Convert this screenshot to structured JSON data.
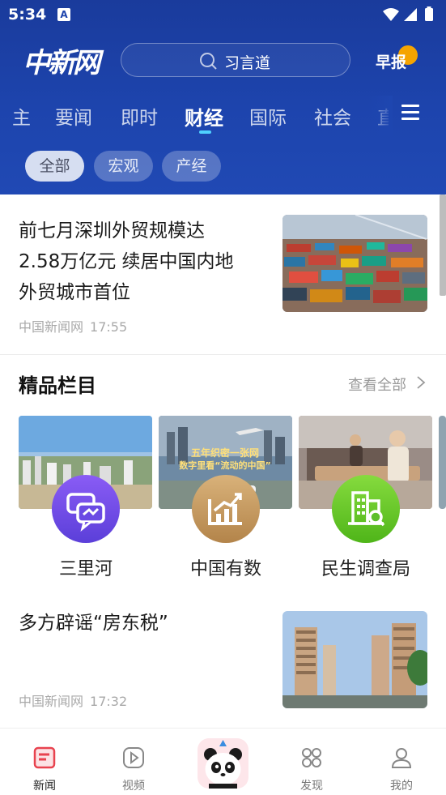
{
  "status_bar": {
    "time": "5:34",
    "notification_icon": "A"
  },
  "header": {
    "logo_text": "中新网",
    "search": {
      "placeholder": "习言道",
      "icon": "search-icon"
    },
    "morning_report": "早报",
    "tabs": [
      "主",
      "要闻",
      "即时",
      "财经",
      "国际",
      "社会",
      "直"
    ],
    "active_tab": "财经",
    "menu_icon": "hamburger-icon",
    "chips": [
      {
        "label": "全部",
        "active": true
      },
      {
        "label": "宏观",
        "active": false
      },
      {
        "label": "产经",
        "active": false
      }
    ]
  },
  "articles": [
    {
      "title_lines": [
        "前七月深圳外贸规模达",
        "2.58万亿元  续居中国内地",
        "外贸城市首位"
      ],
      "source": "中国新闻网",
      "time": "17:55",
      "thumbnail": "shipping-containers-port"
    },
    {
      "title_lines": [
        "多方辟谣“房东税”"
      ],
      "source": "中国新闻网",
      "time": "17:32",
      "thumbnail": "apartment-buildings"
    }
  ],
  "premium": {
    "title": "精品栏目",
    "see_all": "查看全部",
    "card_banner_text": [
      "五年织密一张网",
      "数字里看“流动的中国”"
    ],
    "items": [
      {
        "label": "三里河",
        "icon": "chat-bubbles-icon",
        "color": "#6b4fe6"
      },
      {
        "label": "中国有数",
        "icon": "chart-growth-icon",
        "color": "#c99a5e"
      },
      {
        "label": "民生调查局",
        "icon": "building-search-icon",
        "color": "#5cbf2a"
      }
    ]
  },
  "bottom_nav": [
    {
      "label": "新闻",
      "icon": "news-icon",
      "active": true
    },
    {
      "label": "视频",
      "icon": "play-icon",
      "active": false
    },
    {
      "label": "",
      "icon": "panda-icon",
      "active": false
    },
    {
      "label": "发现",
      "icon": "discover-icon",
      "active": false
    },
    {
      "label": "我的",
      "icon": "profile-icon",
      "active": false
    }
  ],
  "colors": {
    "header_blue": "#1d44ad",
    "accent_underline": "#4fd1ff",
    "active_nav": "#e8434f",
    "morning_dot": "#f5a400"
  }
}
